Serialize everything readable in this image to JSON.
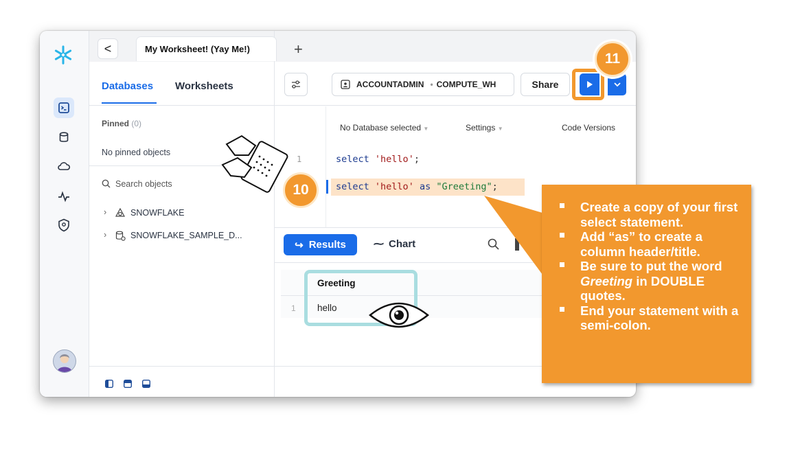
{
  "worksheet": {
    "back": "<",
    "tab_title": "My Worksheet! (Yay Me!)",
    "new_tab": "+"
  },
  "left_panel": {
    "tabs": [
      "Databases",
      "Worksheets"
    ],
    "pinned_label": "Pinned",
    "pinned_count": "(0)",
    "no_pinned": "No pinned objects",
    "search_placeholder": "Search objects",
    "tree": [
      "SNOWFLAKE",
      "SNOWFLAKE_SAMPLE_D..."
    ]
  },
  "toolbar": {
    "role": "ACCOUNTADMIN",
    "dot": "•",
    "warehouse": "COMPUTE_WH",
    "share": "Share"
  },
  "editor_bar": {
    "database": "No Database selected",
    "settings": "Settings",
    "versions": "Code Versions"
  },
  "editor": {
    "line1_no": "1",
    "line1": {
      "kw": "select",
      "str": "'hello'",
      "end": ";"
    },
    "line2": {
      "kw": "select",
      "str": "'hello'",
      "as": "as",
      "id": "\"Greeting\"",
      "end": ";"
    }
  },
  "results": {
    "results_tab": "Results",
    "chart_tab": "Chart",
    "column": "Greeting",
    "row_no": "1",
    "value": "hello"
  },
  "badges": {
    "ten": "10",
    "eleven": "11"
  },
  "callout": {
    "items": [
      "Create a copy of your first select statement.",
      "Add “as” to create a column header/title.",
      "Be sure to put the word Greeting in DOUBLE quotes.",
      "End your statement with a semi-colon."
    ]
  },
  "colors": {
    "accent": "#1a6ce8",
    "orange": "#f2982e",
    "highlight": "#fde3c8",
    "teal": "#a9dde0"
  },
  "icons": [
    "snowflake-logo",
    "worksheet-icon",
    "database-icon",
    "cloud-icon",
    "activity-icon",
    "shield-icon",
    "avatar",
    "panel-layout-icons",
    "typing-hands-icon",
    "eye-icon"
  ]
}
